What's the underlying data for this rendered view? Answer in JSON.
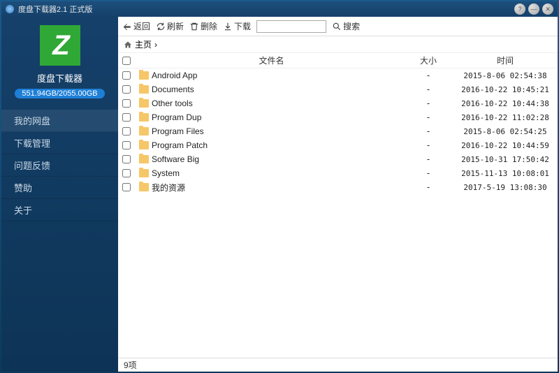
{
  "window": {
    "title": "度盘下载器2.1 正式版"
  },
  "sidebar": {
    "app_name": "度盘下载器",
    "storage": "551.94GB/2055.00GB",
    "nav": [
      {
        "label": "我的网盘"
      },
      {
        "label": "下载管理"
      },
      {
        "label": "问题反馈"
      },
      {
        "label": "赞助"
      },
      {
        "label": "关于"
      }
    ]
  },
  "toolbar": {
    "back": "返回",
    "refresh": "刷新",
    "delete": "删除",
    "download": "下载",
    "search": "搜索"
  },
  "breadcrumb": {
    "home": "主页"
  },
  "columns": {
    "name": "文件名",
    "size": "大小",
    "time": "时间"
  },
  "files": [
    {
      "name": "Android App",
      "size": "-",
      "time": "2015-8-06 02:54:38"
    },
    {
      "name": "Documents",
      "size": "-",
      "time": "2016-10-22 10:45:21"
    },
    {
      "name": "Other tools",
      "size": "-",
      "time": "2016-10-22 10:44:38"
    },
    {
      "name": "Program Dup",
      "size": "-",
      "time": "2016-10-22 11:02:28"
    },
    {
      "name": "Program Files",
      "size": "-",
      "time": "2015-8-06 02:54:25"
    },
    {
      "name": "Program Patch",
      "size": "-",
      "time": "2016-10-22 10:44:59"
    },
    {
      "name": "Software Big",
      "size": "-",
      "time": "2015-10-31 17:50:42"
    },
    {
      "name": "System",
      "size": "-",
      "time": "2015-11-13 10:08:01"
    },
    {
      "name": "我的资源",
      "size": "-",
      "time": "2017-5-19 13:08:30"
    }
  ],
  "status": {
    "count": "9项"
  }
}
